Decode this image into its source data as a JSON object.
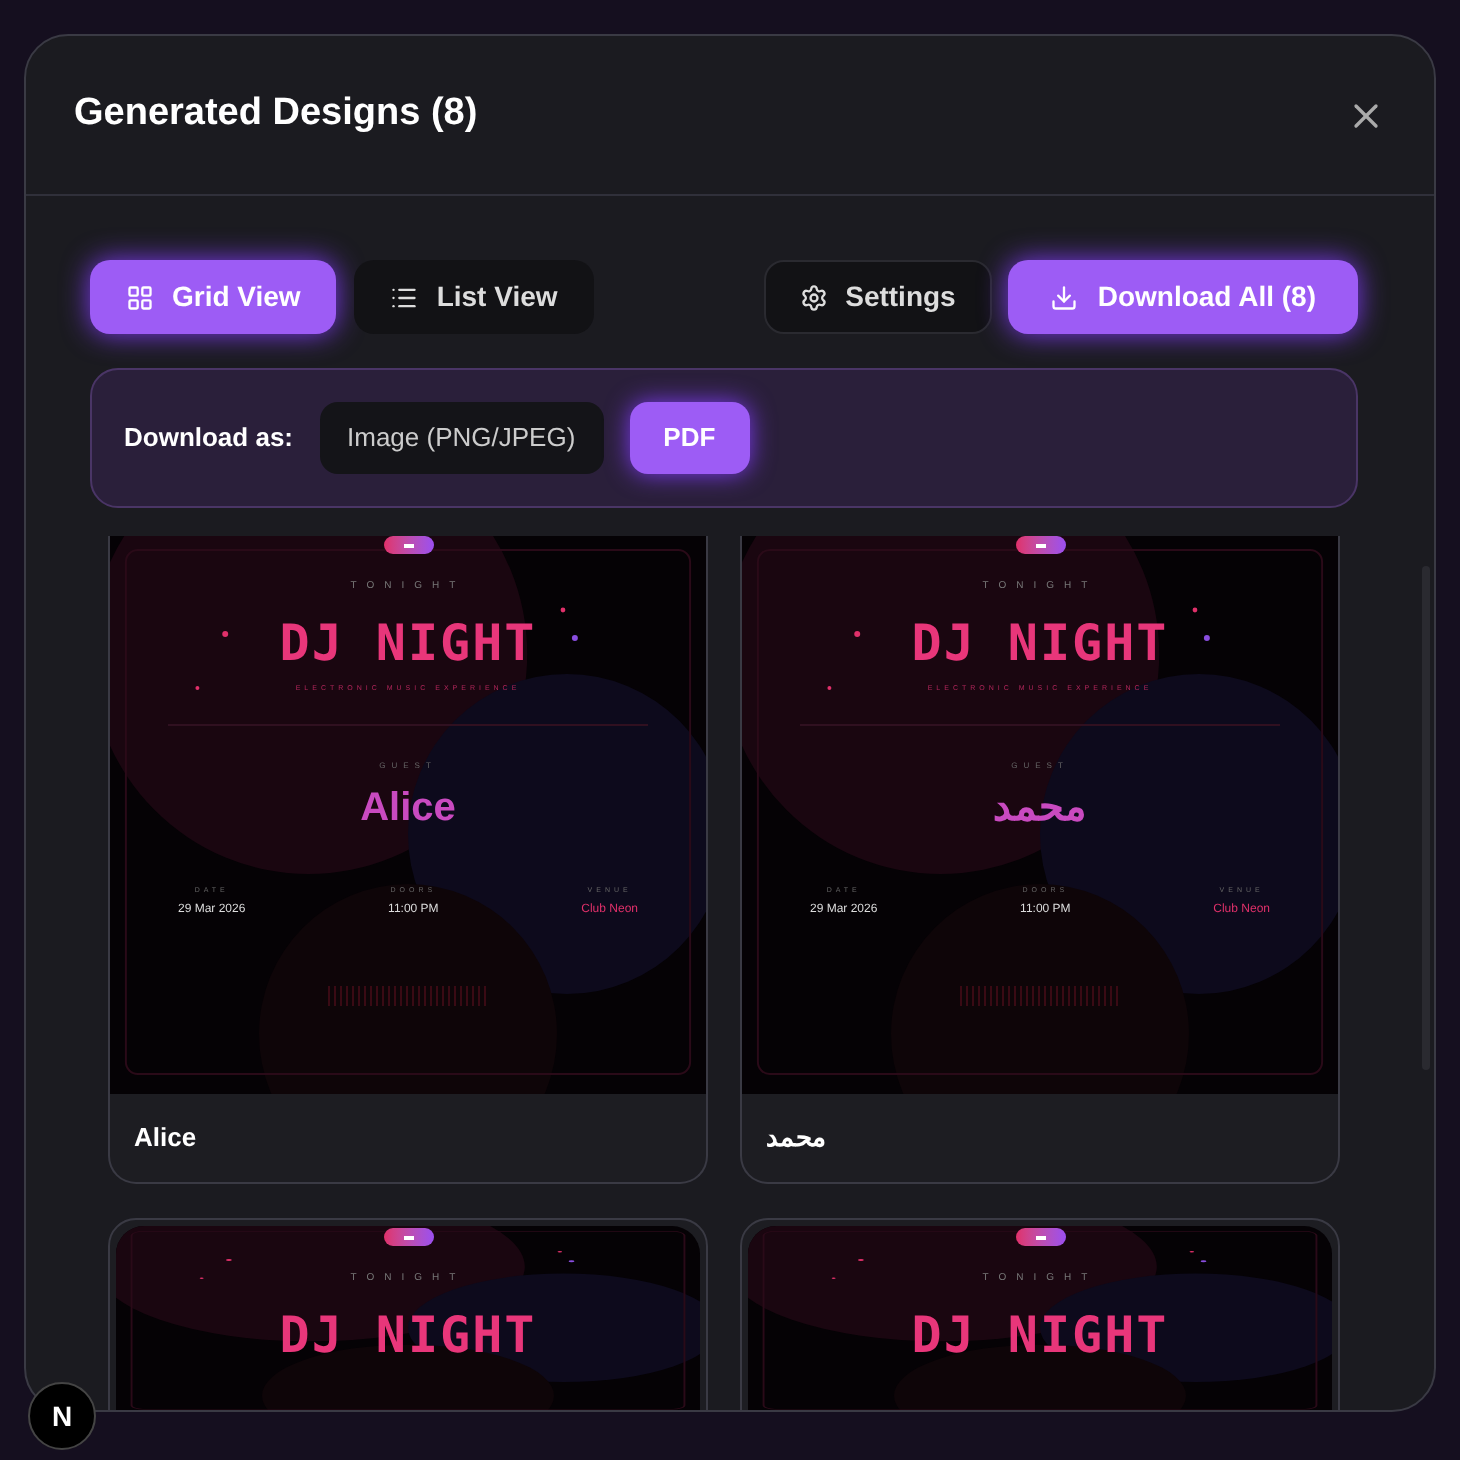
{
  "dialog": {
    "title": "Generated Designs (8)"
  },
  "view_tabs": [
    {
      "label": "Grid View",
      "kind": "grid",
      "selected": true
    },
    {
      "label": "List View",
      "kind": "list",
      "selected": false
    }
  ],
  "settings_button": {
    "label": "Settings"
  },
  "download_all_button": {
    "label": "Download All (8)"
  },
  "download_options": {
    "label": "Download as:",
    "formats": [
      {
        "label": "Image (PNG/JPEG)",
        "selected": false
      },
      {
        "label": "PDF",
        "selected": true
      }
    ]
  },
  "designs": [
    {
      "tonight": "TONIGHT",
      "title": "DJ NIGHT",
      "subtitle": "ELECTRONIC MUSIC EXPERIENCE",
      "guest_label": "GUEST",
      "guest": "Alice",
      "details": [
        {
          "label": "DATE",
          "value": "29 Mar 2026",
          "accent": false
        },
        {
          "label": "DOORS",
          "value": "11:00 PM",
          "accent": false
        },
        {
          "label": "VENUE",
          "value": "Club Neon",
          "accent": true
        }
      ],
      "name": "Alice"
    },
    {
      "tonight": "TONIGHT",
      "title": "DJ NIGHT",
      "subtitle": "ELECTRONIC MUSIC EXPERIENCE",
      "guest_label": "GUEST",
      "guest": "محمد",
      "details": [
        {
          "label": "DATE",
          "value": "29 Mar 2026",
          "accent": false
        },
        {
          "label": "DOORS",
          "value": "11:00 PM",
          "accent": false
        },
        {
          "label": "VENUE",
          "value": "Club Neon",
          "accent": true
        }
      ],
      "name": "محمد"
    },
    {
      "tonight": "TONIGHT",
      "title": "DJ NIGHT"
    },
    {
      "tonight": "TONIGHT",
      "title": "DJ NIGHT"
    }
  ],
  "dev_badge": {
    "label": "N"
  }
}
